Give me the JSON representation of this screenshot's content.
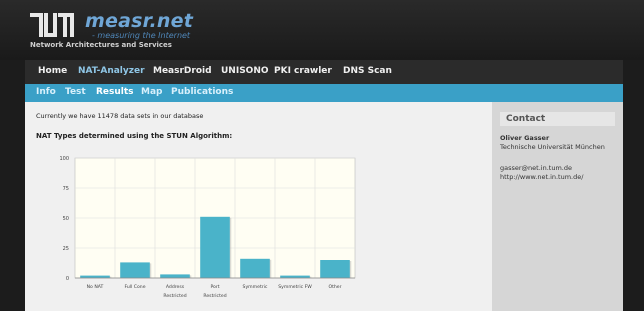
{
  "header": {
    "brand": "measr.net",
    "tagline": "- measuring the Internet",
    "subtitle": "Network Architectures and Services"
  },
  "nav": {
    "main": [
      "Home",
      "NAT-Analyzer",
      "MeasrDroid",
      "UNISONO",
      "PKI crawler",
      "DNS Scan"
    ],
    "main_active": "NAT-Analyzer",
    "sub": [
      "Info",
      "Test",
      "Results",
      "Map",
      "Publications"
    ],
    "sub_active": "Results"
  },
  "content": {
    "intro": "Currently we have 11478 data sets in our database",
    "heading": "NAT Types determined using the STUN Algorithm:"
  },
  "chart_data": {
    "type": "bar",
    "categories": [
      "No NAT",
      "Full Cone",
      "Address Restricted",
      "Port Restricted",
      "Symmetric",
      "Symmetric FW",
      "Other"
    ],
    "category_lines": [
      [
        "No NAT"
      ],
      [
        "Full Cone"
      ],
      [
        "Address",
        "Restricted"
      ],
      [
        "Port",
        "Restricted"
      ],
      [
        "Symmetric"
      ],
      [
        "Symmetric FW"
      ],
      [
        "Other"
      ]
    ],
    "values": [
      2,
      13,
      3,
      51,
      16,
      2,
      15
    ],
    "ylim": [
      0,
      100
    ],
    "yticks": [
      0,
      25,
      50,
      75,
      100
    ],
    "grid": true,
    "bar_color": "#4ab3c9",
    "title": "",
    "xlabel": "",
    "ylabel": ""
  },
  "sidebar": {
    "title": "Contact",
    "name": "Oliver Gasser",
    "org": "Technische Universität München",
    "email": "gasser@net.in.tum.de",
    "url": "http://www.net.in.tum.de/"
  }
}
